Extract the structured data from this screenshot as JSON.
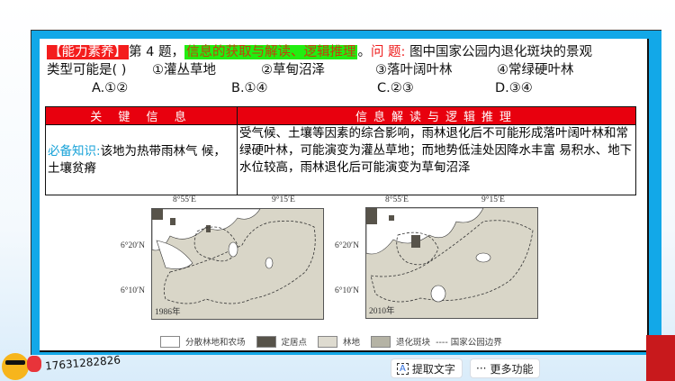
{
  "question": {
    "tag": "【能力素养】",
    "number": "第 4 题，",
    "skill": "信息的获取与解读、逻辑推理",
    "period": "。",
    "label": "问 题:",
    "stem_1": "图中国家公园内退化斑块的景观",
    "stem_2": "类型可能是(   )",
    "items": [
      "①灌丛草地",
      "②草甸沼泽",
      "③落叶阔叶林",
      "④常绿硬叶林"
    ],
    "choices": [
      "A.①②",
      "B.①④",
      "C.②③",
      "D.③④"
    ]
  },
  "table": {
    "headers": [
      "关 键 信 息",
      "信息解读与逻辑推理"
    ],
    "key_label": "必备知识:",
    "key_text": "该地为热带雨林气 候，土壤贫瘠",
    "reasoning": "受气候、土壤等因素的综合影响，雨林退化后不可能形成落叶阔叶林和常绿硬叶林，可能演变为灌丛草地；而地势低洼处因降水丰富 易积水、地下水位较高，雨林退化后可能演变为草甸沼泽"
  },
  "maps": [
    {
      "year": "1986年",
      "lon": [
        "8°55′E",
        "9°15′E"
      ],
      "lat": [
        "6°20′N",
        "6°10′N"
      ]
    },
    {
      "year": "2010年",
      "lon": [
        "8°55′E",
        "9°15′E"
      ],
      "lat": [
        "6°20′N",
        "6°10′N"
      ]
    }
  ],
  "legend": [
    {
      "label": "分散林地和农场",
      "color": "#ffffff"
    },
    {
      "label": "定居点",
      "color": "#57534a"
    },
    {
      "label": "林地",
      "color": "#dedbd0"
    },
    {
      "label": "退化斑块",
      "color": "#b5b3a5"
    },
    {
      "label": "---- 国家公园边界",
      "color": ""
    }
  ],
  "bottom": {
    "phone": "17631282826",
    "extract_text": "提取文字",
    "more": "更多功能"
  }
}
